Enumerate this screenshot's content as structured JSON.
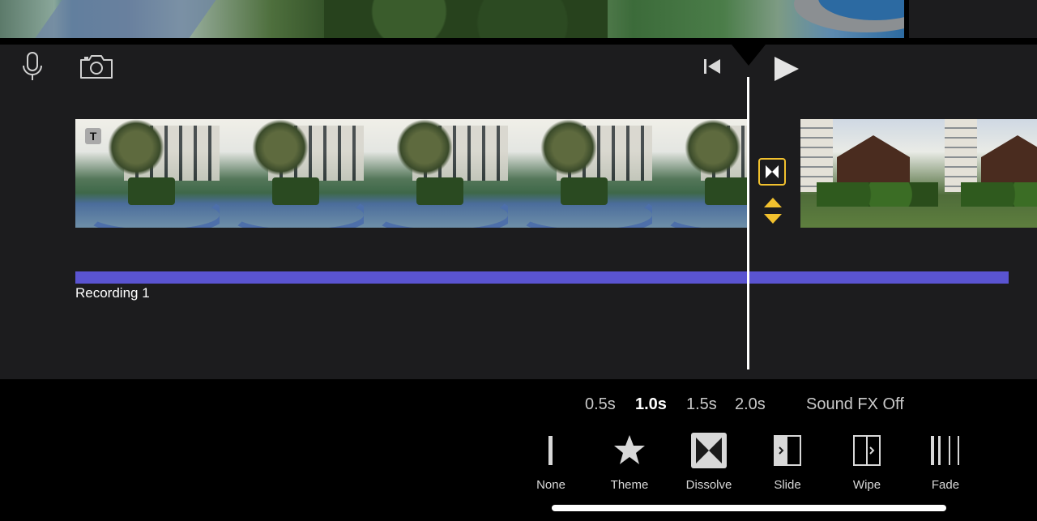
{
  "icons": {
    "microphone": "microphone-icon",
    "camera": "camera-icon",
    "skip_back": "skip-to-start-icon",
    "play": "play-icon",
    "title": "title-text-icon",
    "transition": "dissolve-transition-icon",
    "adjust": "up-down-arrows-icon"
  },
  "timeline": {
    "clip_title_badge": "T",
    "audio_clip_label": "Recording 1"
  },
  "durations": {
    "options": [
      "0.5s",
      "1.0s",
      "1.5s",
      "2.0s"
    ],
    "selected": "1.0s",
    "sound_fx": "Sound FX Off"
  },
  "transitions": {
    "items": [
      {
        "label": "None",
        "icon": "none-transition-icon"
      },
      {
        "label": "Theme",
        "icon": "star-icon"
      },
      {
        "label": "Dissolve",
        "icon": "dissolve-icon"
      },
      {
        "label": "Slide",
        "icon": "slide-icon"
      },
      {
        "label": "Wipe",
        "icon": "wipe-icon"
      },
      {
        "label": "Fade",
        "icon": "fade-icon"
      }
    ],
    "selected": "Dissolve"
  },
  "colors": {
    "accent_yellow": "#f2c12e",
    "audio_purple": "#5a54d1",
    "timeline_bg": "#1c1c1e"
  }
}
